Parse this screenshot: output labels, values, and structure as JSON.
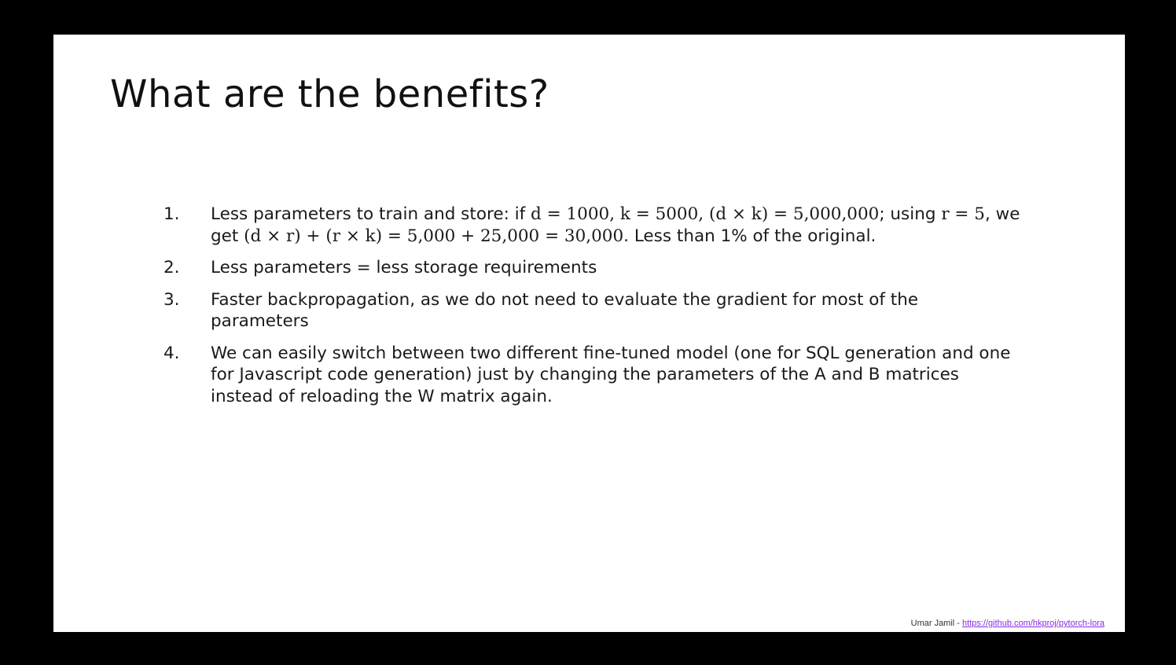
{
  "slide": {
    "title": "What are the benefits?",
    "items": [
      {
        "number": "1.",
        "parts": {
          "t1": "Less parameters to train and store: if ",
          "m1": "d = 1000, k = 5000, (d × k) = 5,000,000",
          "t2": "; using ",
          "m2": "r = 5",
          "t3": ", we get ",
          "m3": "(d × r) + (r × k) = 5,000 + 25,000 = 30,000",
          "t4": ". Less than 1% of the original."
        }
      },
      {
        "number": "2.",
        "text": "Less parameters = less storage requirements"
      },
      {
        "number": "3.",
        "text": "Faster backpropagation, as we do not need to evaluate the gradient for most of the parameters"
      },
      {
        "number": "4.",
        "text": "We can easily switch between two different fine-tuned model (one for SQL generation and one for Javascript code generation) just by changing the parameters of the A and B matrices instead of reloading the W matrix again."
      }
    ]
  },
  "footer": {
    "author": "Umar Jamil - ",
    "link": "https://github.com/hkproj/pytorch-lora"
  },
  "colors": {
    "background": "#000000",
    "slide": "#ffffff",
    "link": "#8a2be2"
  }
}
